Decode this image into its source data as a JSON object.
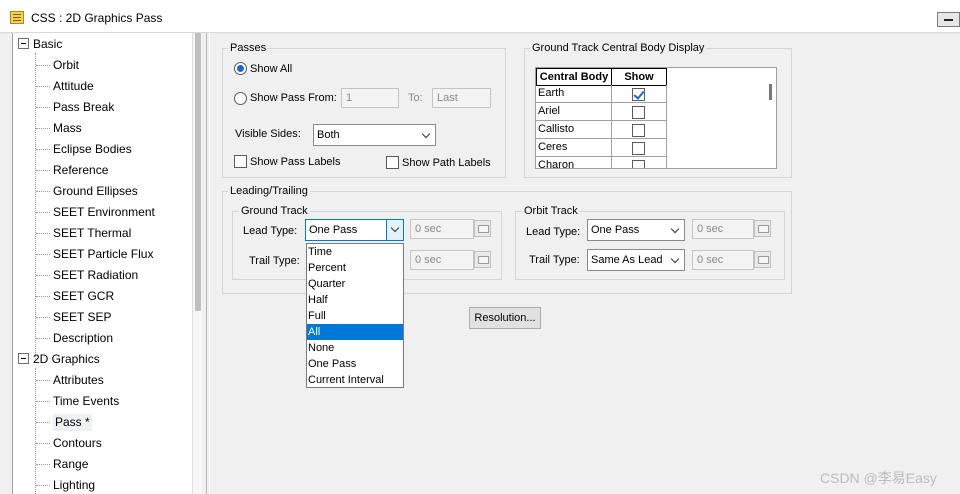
{
  "window": {
    "title": "CSS : 2D Graphics Pass"
  },
  "tree": {
    "group1": {
      "label": "Basic",
      "children": [
        "Orbit",
        "Attitude",
        "Pass Break",
        "Mass",
        "Eclipse Bodies",
        "Reference",
        "Ground Ellipses",
        "SEET Environment",
        "SEET Thermal",
        "SEET Particle Flux",
        "SEET Radiation",
        "SEET GCR",
        "SEET SEP",
        "Description"
      ]
    },
    "group2": {
      "label": "2D Graphics",
      "children": [
        "Attributes",
        "Time Events",
        "Pass *",
        "Contours",
        "Range",
        "Lighting"
      ]
    }
  },
  "passes": {
    "group_label": "Passes",
    "show_all": "Show All",
    "show_pass_from": "Show Pass From:",
    "from_value": "1",
    "to_label": "To:",
    "to_value": "Last",
    "visible_sides_label": "Visible Sides:",
    "visible_sides_value": "Both",
    "show_pass_labels": "Show Pass Labels",
    "show_path_labels": "Show Path Labels"
  },
  "ground_track_display": {
    "group_label": "Ground Track Central Body Display",
    "headers": [
      "Central Body",
      "Show"
    ],
    "rows": [
      {
        "body": "Earth",
        "show": true
      },
      {
        "body": "Ariel",
        "show": false
      },
      {
        "body": "Callisto",
        "show": false
      },
      {
        "body": "Ceres",
        "show": false
      },
      {
        "body": "Charon",
        "show": false
      }
    ]
  },
  "leading_trailing": {
    "group_label": "Leading/Trailing",
    "ground_track": {
      "label": "Ground Track",
      "lead_type_label": "Lead Type:",
      "lead_type_value": "One Pass",
      "lead_sec": "0 sec",
      "trail_type_label": "Trail Type:",
      "trail_sec": "0 sec"
    },
    "orbit_track": {
      "label": "Orbit Track",
      "lead_type_label": "Lead Type:",
      "lead_type_value": "One Pass",
      "lead_sec": "0 sec",
      "trail_type_label": "Trail Type:",
      "trail_type_value": "Same As Lead",
      "trail_sec": "0 sec"
    }
  },
  "resolution_button": "Resolution...",
  "dropdown": {
    "options": [
      "Time",
      "Percent",
      "Quarter",
      "Half",
      "Full",
      "All",
      "None",
      "One Pass",
      "Current Interval"
    ],
    "highlighted": "All"
  },
  "watermark": "CSDN @李易Easy",
  "colors": {
    "accent": "#0078d7",
    "check": "#1b66c6"
  }
}
